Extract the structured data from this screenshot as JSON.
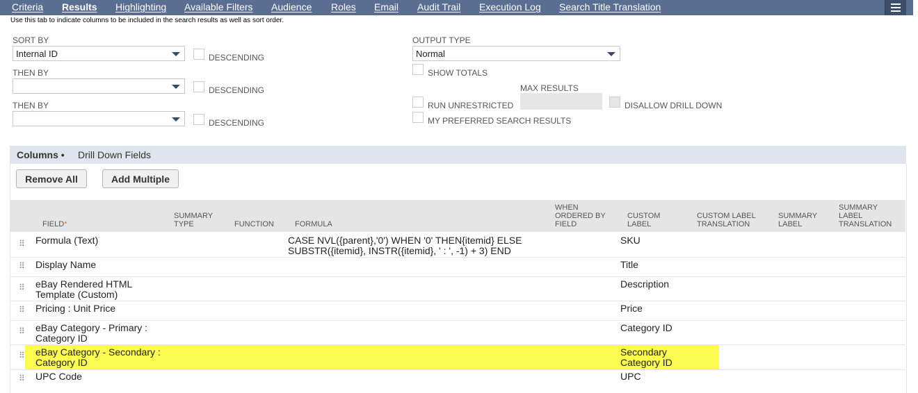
{
  "tabs": [
    {
      "label": "Criteria",
      "active": false
    },
    {
      "label": "Results",
      "active": true
    },
    {
      "label": "Highlighting",
      "active": false
    },
    {
      "label": "Available Filters",
      "active": false
    },
    {
      "label": "Audience",
      "active": false
    },
    {
      "label": "Roles",
      "active": false
    },
    {
      "label": "Email",
      "active": false
    },
    {
      "label": "Audit Trail",
      "active": false
    },
    {
      "label": "Execution Log",
      "active": false
    },
    {
      "label": "Search Title Translation",
      "active": false
    }
  ],
  "help_text": "Use this tab to indicate columns to be included in the search results as well as sort order.",
  "sort": {
    "sort_by_label": "SORT BY",
    "sort_by_value": "Internal ID",
    "then_by_label_1": "THEN BY",
    "then_by_value_1": "",
    "then_by_label_2": "THEN BY",
    "then_by_value_2": "",
    "descending_label": "DESCENDING"
  },
  "output": {
    "output_type_label": "OUTPUT TYPE",
    "output_type_value": "Normal",
    "show_totals_label": "SHOW TOTALS",
    "max_results_label": "MAX RESULTS",
    "run_unrestricted_label": "RUN UNRESTRICTED",
    "disallow_drill_down_label": "DISALLOW DRILL DOWN",
    "my_preferred_label": "MY PREFERRED SEARCH RESULTS"
  },
  "subtabs": {
    "columns_label": "Columns •",
    "drill_down_label": "Drill Down Fields"
  },
  "buttons": {
    "remove_all": "Remove All",
    "add_multiple": "Add Multiple"
  },
  "table": {
    "headers": {
      "field": "FIELD",
      "required_mark": "*",
      "summary_type_1": "SUMMARY",
      "summary_type_2": "TYPE",
      "function": "FUNCTION",
      "formula": "FORMULA",
      "when_ordered_1": "WHEN",
      "when_ordered_2": "ORDERED BY",
      "when_ordered_3": "FIELD",
      "custom_label_1": "CUSTOM",
      "custom_label_2": "LABEL",
      "custom_label_translation_1": "CUSTOM LABEL",
      "custom_label_translation_2": "TRANSLATION",
      "summary_label_1": "SUMMARY",
      "summary_label_2": "LABEL",
      "summary_label_translation_1": "SUMMARY",
      "summary_label_translation_2": "LABEL",
      "summary_label_translation_3": "TRANSLATION"
    },
    "rows": [
      {
        "field_1": "Formula (Text)",
        "field_2": "",
        "formula_1": "CASE NVL({parent},'0') WHEN '0' THEN{itemid} ELSE",
        "formula_2": "SUBSTR({itemid}, INSTR({itemid}, ' : ', -1) + 3) END",
        "label_1": "SKU",
        "label_2": ""
      },
      {
        "field_1": "Display Name",
        "field_2": "",
        "formula_1": "",
        "formula_2": "",
        "label_1": "Title",
        "label_2": ""
      },
      {
        "field_1": "eBay Rendered HTML",
        "field_2": "Template (Custom)",
        "formula_1": "",
        "formula_2": "",
        "label_1": "Description",
        "label_2": ""
      },
      {
        "field_1": "Pricing : Unit Price",
        "field_2": "",
        "formula_1": "",
        "formula_2": "",
        "label_1": "Price",
        "label_2": ""
      },
      {
        "field_1": "eBay Category - Primary :",
        "field_2": "Category ID",
        "formula_1": "",
        "formula_2": "",
        "label_1": "Category ID",
        "label_2": ""
      },
      {
        "field_1": "eBay Category - Secondary :",
        "field_2": "Category ID",
        "formula_1": "",
        "formula_2": "",
        "label_1": "Secondary",
        "label_2": "Category ID",
        "highlighted": true
      },
      {
        "field_1": "UPC Code",
        "field_2": "",
        "formula_1": "",
        "formula_2": "",
        "label_1": "UPC",
        "label_2": ""
      }
    ]
  },
  "colors": {
    "tab_bar": "#5a6e92",
    "highlight": "#fbfb50",
    "subtab_bar": "#dfe4ee"
  }
}
